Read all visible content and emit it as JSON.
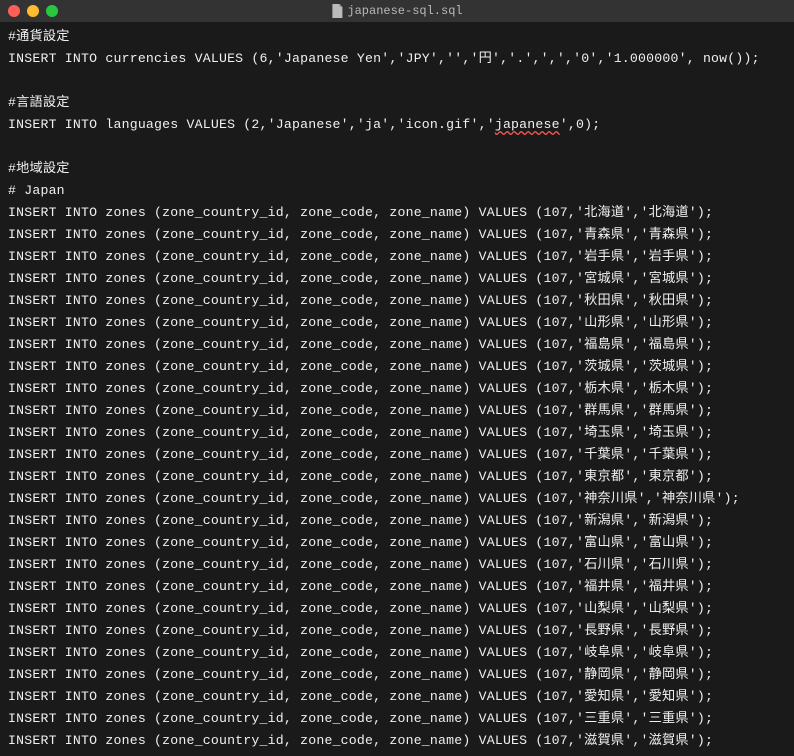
{
  "window": {
    "title": "japanese-sql.sql"
  },
  "comments": {
    "currency": "#通貨設定",
    "language": "#言語設定",
    "region": "#地域設定",
    "japan": "# Japan"
  },
  "sql": {
    "currency": "INSERT INTO currencies VALUES (6,'Japanese Yen','JPY','','円','.',',','0','1.000000', now());",
    "language_prefix": "INSERT INTO languages VALUES (2,'Japanese','ja','icon.gif','",
    "language_spell": "japanese",
    "language_suffix": "',0);",
    "zone_prefix": "INSERT INTO zones (zone_country_id, zone_code, zone_name) VALUES (107,'",
    "zone_partial_prefix": "INSERT INTO zones (zone_country_id, zone_code, zone_name) VALUES (107,'"
  },
  "zones": [
    {
      "code": "北海道",
      "name": "北海道"
    },
    {
      "code": "青森県",
      "name": "青森県"
    },
    {
      "code": "岩手県",
      "name": "岩手県"
    },
    {
      "code": "宮城県",
      "name": "宮城県"
    },
    {
      "code": "秋田県",
      "name": "秋田県"
    },
    {
      "code": "山形県",
      "name": "山形県"
    },
    {
      "code": "福島県",
      "name": "福島県"
    },
    {
      "code": "茨城県",
      "name": "茨城県"
    },
    {
      "code": "栃木県",
      "name": "栃木県"
    },
    {
      "code": "群馬県",
      "name": "群馬県"
    },
    {
      "code": "埼玉県",
      "name": "埼玉県"
    },
    {
      "code": "千葉県",
      "name": "千葉県"
    },
    {
      "code": "東京都",
      "name": "東京都"
    },
    {
      "code": "神奈川県",
      "name": "神奈川県"
    },
    {
      "code": "新潟県",
      "name": "新潟県"
    },
    {
      "code": "富山県",
      "name": "富山県"
    },
    {
      "code": "石川県",
      "name": "石川県"
    },
    {
      "code": "福井県",
      "name": "福井県"
    },
    {
      "code": "山梨県",
      "name": "山梨県"
    },
    {
      "code": "長野県",
      "name": "長野県"
    },
    {
      "code": "岐阜県",
      "name": "岐阜県"
    },
    {
      "code": "静岡県",
      "name": "静岡県"
    },
    {
      "code": "愛知県",
      "name": "愛知県"
    },
    {
      "code": "三重県",
      "name": "三重県"
    }
  ],
  "partial_zone": {
    "code": "滋賀県",
    "name": "滋賀県"
  }
}
